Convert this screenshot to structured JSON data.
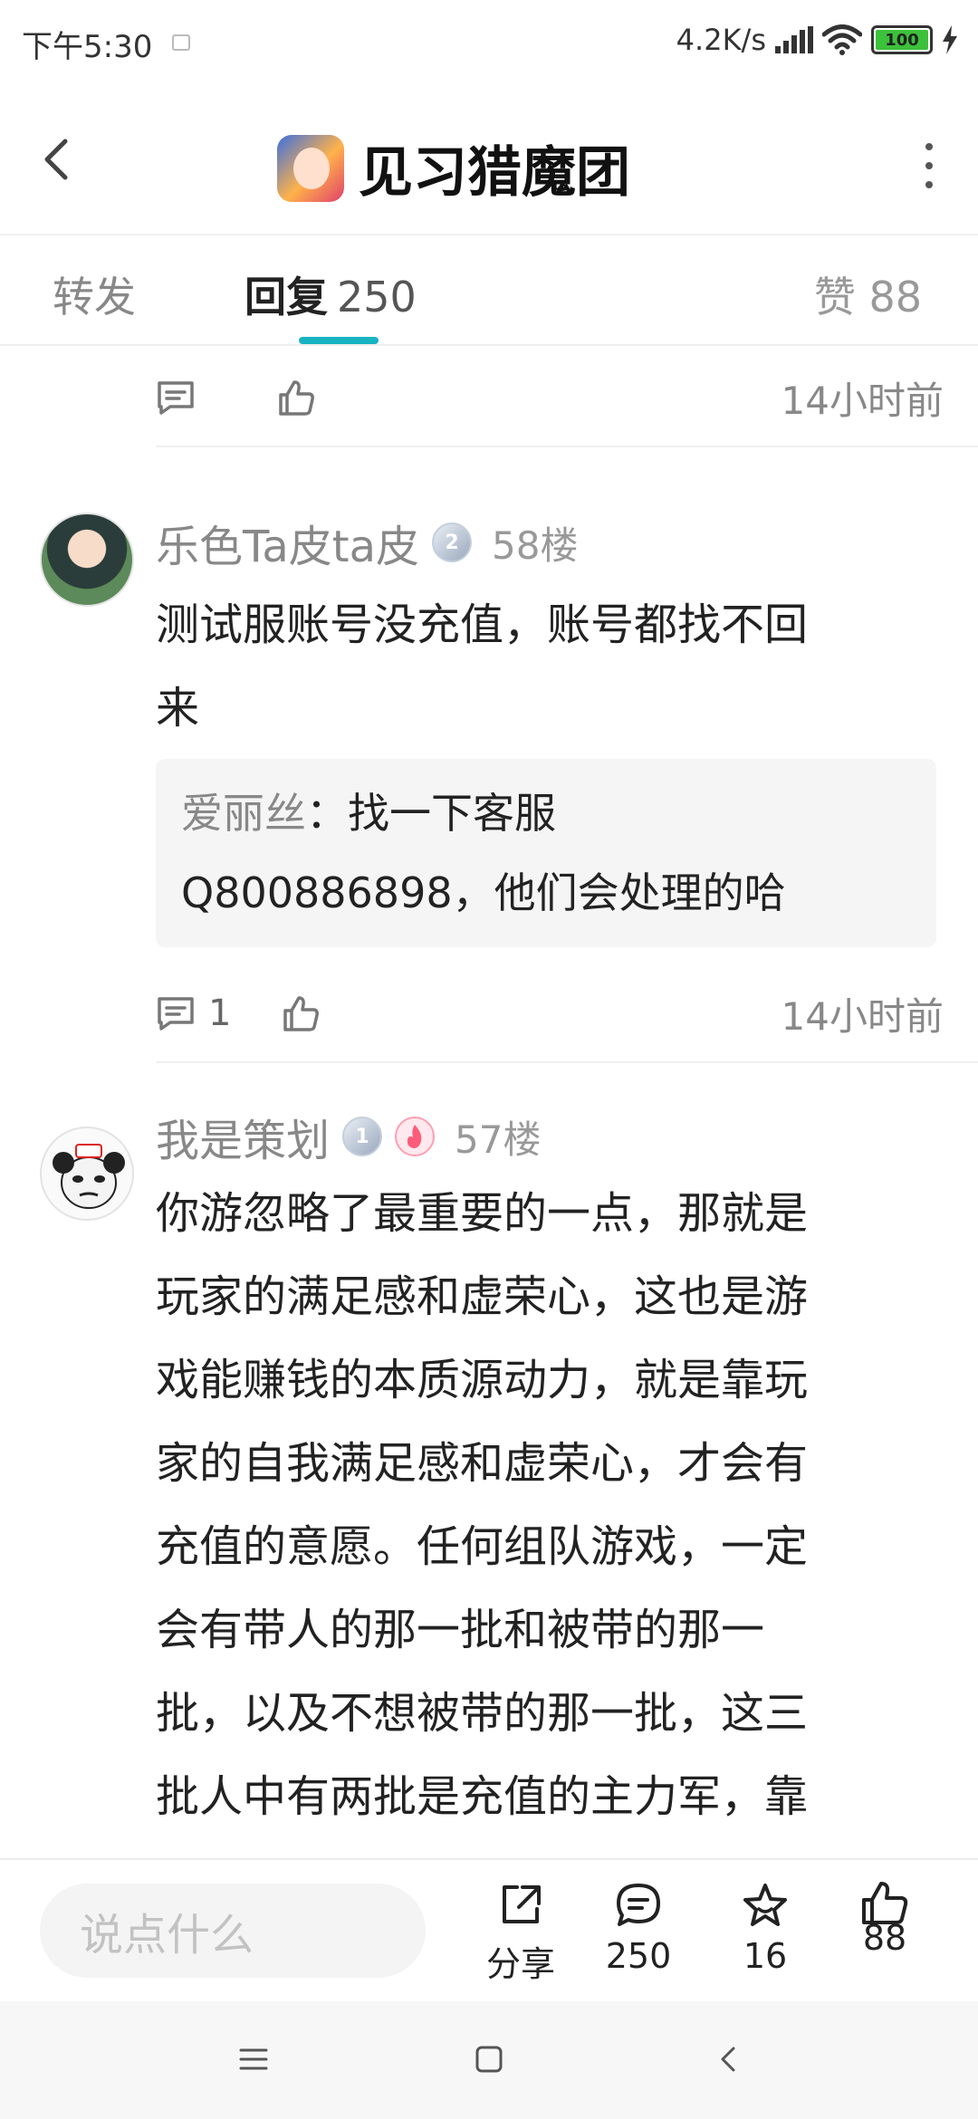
{
  "status_bar": {
    "time": "下午5:30",
    "net_speed": "4.2K/s",
    "battery": "100"
  },
  "header": {
    "title": "见习猎魔团"
  },
  "tabs": {
    "forward": "转发",
    "reply": "回复",
    "reply_count": "250",
    "like": "赞 88"
  },
  "feed": {
    "top_actions": {
      "time": "14小时前"
    },
    "posts": [
      {
        "username": "乐色Ta皮ta皮",
        "level": "2",
        "floor": "58楼",
        "content_lines": [
          "测试服账号没充值，账号都找不回",
          "来"
        ],
        "reply_quote": {
          "name": "爱丽丝",
          "sep": "：",
          "lines": [
            "找一下客服",
            "Q800886898，他们会处理的哈"
          ]
        },
        "comment_count": "1",
        "time": "14小时前"
      },
      {
        "username": "我是策划",
        "level": "1",
        "floor": "57楼",
        "content_lines": [
          "你游忽略了最重要的一点，那就是",
          "玩家的满足感和虚荣心，这也是游",
          "戏能赚钱的本质源动力，就是靠玩",
          "家的自我满足感和虚荣心，才会有",
          "充值的意愿。任何组队游戏，一定",
          "会有带人的那一批和被带的那一",
          "批，以及不想被带的那一批，这三",
          "批人中有两批是充值的主力军，靠"
        ]
      }
    ]
  },
  "bottom_bar": {
    "input_placeholder": "说点什么",
    "share_label": "分享",
    "comment_count": "250",
    "favorite_count": "16",
    "like_count": "88"
  },
  "colors": {
    "accent": "#17b3c2"
  }
}
